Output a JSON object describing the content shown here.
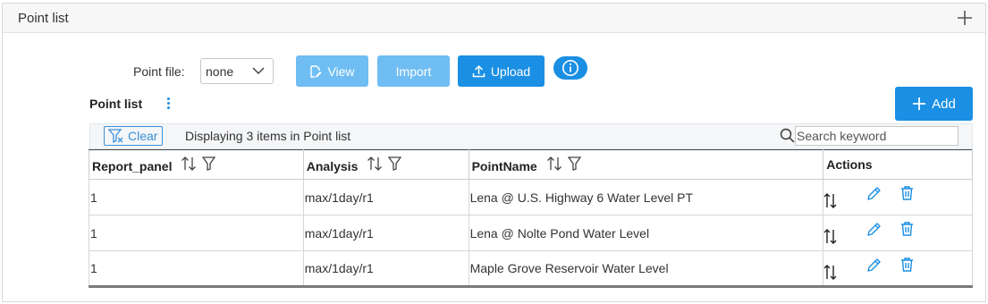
{
  "panel": {
    "title": "Point list",
    "expand_icon": "plus-icon"
  },
  "point_file": {
    "label": "Point file:",
    "selected": "none",
    "buttons": {
      "view": "View",
      "import": "Import",
      "upload": "Upload"
    },
    "info_icon": "info-icon"
  },
  "list": {
    "title": "Point list",
    "add_label": "Add",
    "clear_label": "Clear",
    "display_text": "Displaying 3 items in Point list",
    "search_placeholder": "Search keyword",
    "columns": [
      "Report_panel",
      "Analysis",
      "PointName",
      "Actions"
    ],
    "rows": [
      {
        "report_panel": "1",
        "analysis": "max/1day/r1",
        "point_name": "Lena @ U.S. Highway 6 Water Level PT"
      },
      {
        "report_panel": "1",
        "analysis": "max/1day/r1",
        "point_name": "Lena @ Nolte Pond Water Level"
      },
      {
        "report_panel": "1",
        "analysis": "max/1day/r1",
        "point_name": "Maple Grove Reservoir Water Level"
      }
    ]
  },
  "colors": {
    "primary": "#1a8fe3",
    "primary_light": "#6fbdf3",
    "link": "#3b8fd9"
  }
}
